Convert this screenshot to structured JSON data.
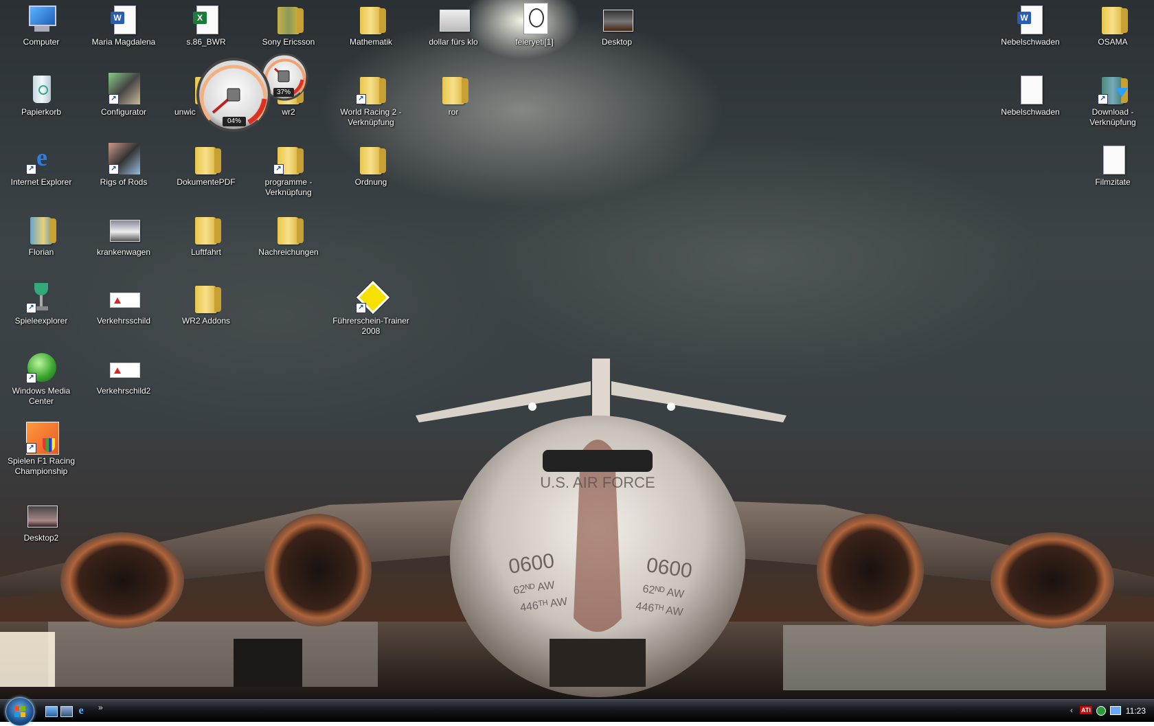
{
  "desktop_icons": [
    {
      "label": "Computer",
      "type": "computer-icon"
    },
    {
      "label": "Papierkorb",
      "type": "recycle-bin-icon"
    },
    {
      "label": "Internet Explorer",
      "type": "internet-explorer-icon"
    },
    {
      "label": "Florian",
      "type": "folder-icon"
    },
    {
      "label": "Spieleexplorer",
      "type": "games-icon"
    },
    {
      "label": "Windows Media Center",
      "type": "media-center-icon"
    },
    {
      "label": "Spielen F1 Racing Championship",
      "type": "game-icon"
    },
    {
      "label": "Desktop2",
      "type": "image-icon"
    },
    {
      "label": "Maria Magdalena",
      "type": "word-document-icon"
    },
    {
      "label": "Configurator",
      "type": "app-icon"
    },
    {
      "label": "Rigs of Rods",
      "type": "app-icon"
    },
    {
      "label": "krankenwagen",
      "type": "image-icon"
    },
    {
      "label": "Verkehrsschild",
      "type": "image-icon"
    },
    {
      "label": "Verkehrschild2",
      "type": "image-icon"
    },
    {
      "label": "s.86_BWR",
      "type": "excel-document-icon"
    },
    {
      "label": "unwic",
      "type": "folder-icon"
    },
    {
      "label": "DokumentePDF",
      "type": "folder-icon"
    },
    {
      "label": "Luftfahrt",
      "type": "folder-icon"
    },
    {
      "label": "WR2 Addons",
      "type": "folder-icon"
    },
    {
      "label": "Sony Ericsson",
      "type": "folder-icon"
    },
    {
      "label": "wr2",
      "type": "folder-icon"
    },
    {
      "label": "programme - Verknüpfung",
      "type": "folder-icon"
    },
    {
      "label": "Nachreichungen",
      "type": "folder-icon"
    },
    {
      "label": "Mathematik",
      "type": "folder-icon"
    },
    {
      "label": "World Racing 2 - Verknüpfung",
      "type": "folder-icon"
    },
    {
      "label": "Ordnung",
      "type": "folder-icon"
    },
    {
      "label": "Führerschein-Trainer 2008",
      "type": "app-icon"
    },
    {
      "label": "dollar fürs klo",
      "type": "image-icon"
    },
    {
      "label": "ror",
      "type": "folder-icon"
    },
    {
      "label": "feieryeti[1]",
      "type": "image-icon"
    },
    {
      "label": "Desktop",
      "type": "image-icon"
    },
    {
      "label": "Nebelschwaden",
      "type": "word-document-icon"
    },
    {
      "label": "Nebelschwaden",
      "type": "text-document-icon"
    },
    {
      "label": "OSAMA",
      "type": "folder-icon"
    },
    {
      "label": "Download - Verknüpfung",
      "type": "download-shortcut-icon"
    },
    {
      "label": "Filmzitate",
      "type": "text-document-icon"
    }
  ],
  "gadget": {
    "cpu_percent": "04%",
    "memory_percent": "37%"
  },
  "aircraft": {
    "tail_number": "0600",
    "unit": "62ᴺᴰ AW",
    "unit2": "446ᵀᴴ AW",
    "lettering": "U.S. AIR FORCE"
  },
  "taskbar": {
    "clock": "11:23",
    "tray_label": "ATI"
  }
}
